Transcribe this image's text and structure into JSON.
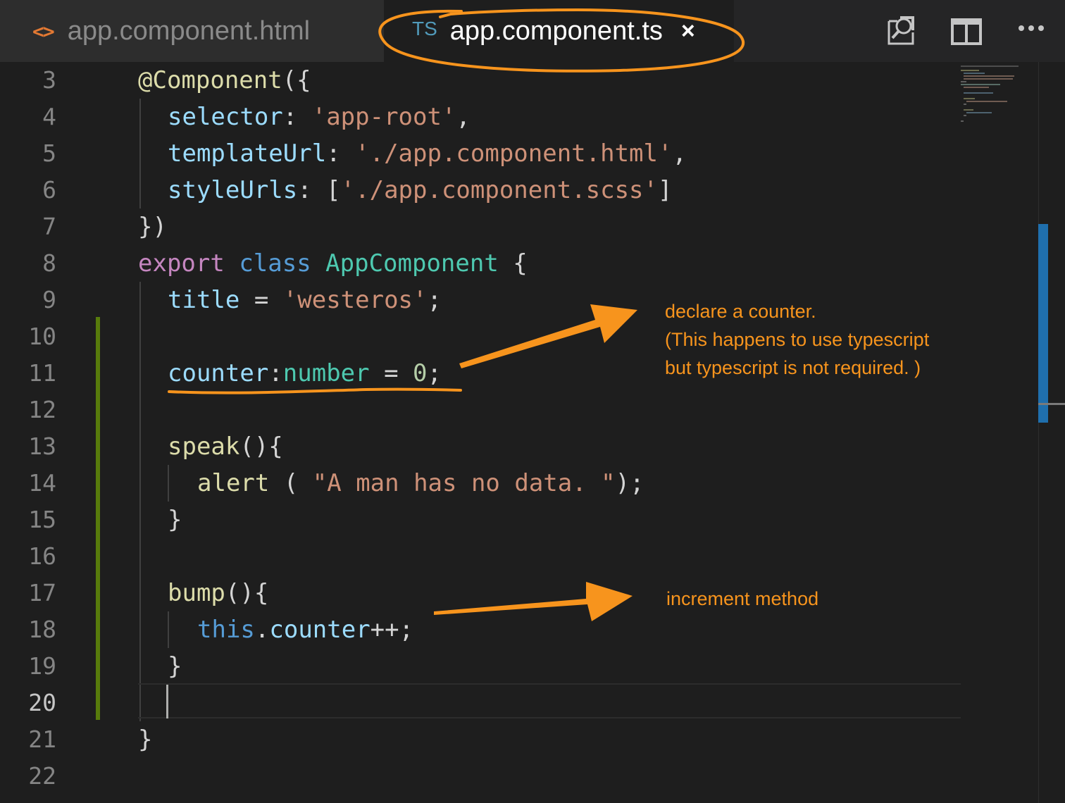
{
  "tabs": [
    {
      "icon": "<>",
      "label": "app.component.html",
      "active": false
    },
    {
      "icon": "TS",
      "label": "app.component.ts",
      "active": true,
      "close": "×"
    }
  ],
  "toolbar": {
    "icons": [
      "open-preview-icon",
      "split-editor-icon",
      "more-actions-icon"
    ],
    "more_label": "•••"
  },
  "editor": {
    "line_numbers": [
      "3",
      "4",
      "5",
      "6",
      "7",
      "8",
      "9",
      "10",
      "11",
      "12",
      "13",
      "14",
      "15",
      "16",
      "17",
      "18",
      "19",
      "20",
      "21",
      "22"
    ],
    "active_line": "20",
    "lines": {
      "l3": {
        "a": "@Component",
        "b": "({"
      },
      "l4": {
        "a": "selector",
        "b": ": ",
        "c": "'app-root'",
        "d": ","
      },
      "l5": {
        "a": "templateUrl",
        "b": ": ",
        "c": "'./app.component.html'",
        "d": ","
      },
      "l6": {
        "a": "styleUrls",
        "b": ": [",
        "c": "'./app.component.scss'",
        "d": "]"
      },
      "l7": {
        "a": "})"
      },
      "l8": {
        "a": "export",
        "b": " ",
        "c": "class",
        "d": " ",
        "e": "AppComponent",
        "f": " {"
      },
      "l9": {
        "a": "title",
        "b": " = ",
        "c": "'westeros'",
        "d": ";"
      },
      "l11": {
        "a": "counter",
        "b": ":",
        "c": "number",
        "d": " = ",
        "e": "0",
        "f": ";"
      },
      "l13": {
        "a": "speak",
        "b": "(){"
      },
      "l14": {
        "a": "alert",
        "b": " ( ",
        "c": "\"A man has no data. \"",
        "d": ");"
      },
      "l15": {
        "a": "}"
      },
      "l17": {
        "a": "bump",
        "b": "(){"
      },
      "l18": {
        "a": "this",
        "b": ".",
        "c": "counter",
        "d": "++;"
      },
      "l19": {
        "a": "}"
      },
      "l21": {
        "a": "}"
      }
    }
  },
  "annotations": {
    "counter_note": [
      "declare a counter.",
      "(This happens to use typescript",
      "but typescript is not required. )"
    ],
    "bump_note": "increment method",
    "color": "#f7941d"
  },
  "colors": {
    "background": "#1e1e1e",
    "tabbar": "#252526",
    "accent": "#1f6fad",
    "git_added": "#587c0c"
  }
}
